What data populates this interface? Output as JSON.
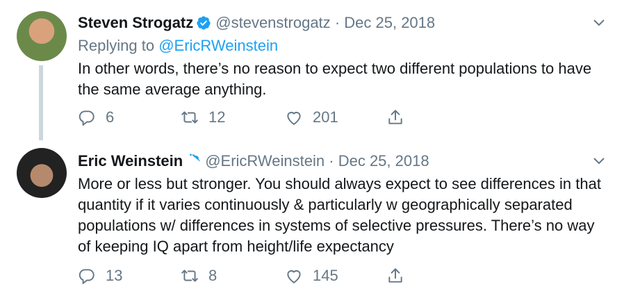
{
  "tweets": [
    {
      "author_name": "Steven Strogatz",
      "handle": "@stevenstrogatz",
      "separator": "·",
      "date": "Dec 25, 2018",
      "replying_prefix": "Replying to",
      "replying_to": "@EricRWeinstein",
      "text": "In other words, there’s no reason to expect two different populations to have the same average anything.",
      "replies": "6",
      "retweets": "12",
      "likes": "201"
    },
    {
      "author_name": "Eric Weinstein",
      "handle": "@EricRWeinstein",
      "separator": "·",
      "date": "Dec 25, 2018",
      "text": "More or less but stronger. You should always expect to see differences in that quantity if it varies continuously & particularly w geographically separated populations w/ differences in systems of selective pressures. There’s no way of keeping IQ apart from height/life expectancy",
      "replies": "13",
      "retweets": "8",
      "likes": "145"
    }
  ],
  "icons": {
    "verified": "verified-badge-icon",
    "chevron": "chevron-down-icon",
    "reply": "reply-icon",
    "retweet": "retweet-icon",
    "like": "heart-icon",
    "share": "share-icon"
  },
  "colors": {
    "text": "#14171a",
    "secondary": "#657786",
    "link": "#1da1f2",
    "thread_line": "#ccd6dd"
  }
}
